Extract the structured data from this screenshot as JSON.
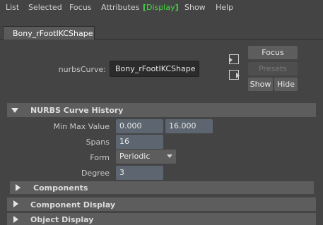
{
  "menu": {
    "list": "List",
    "selected": "Selected",
    "focus": "Focus",
    "attributes": "Attributes",
    "display": "Display",
    "show": "Show",
    "help": "Help"
  },
  "tab": {
    "label": "Bony_rFootIKCShape"
  },
  "node": {
    "label": "nurbsCurve:",
    "value": "Bony_rFootIKCShape"
  },
  "side_buttons": {
    "focus": "Focus",
    "presets": "Presets",
    "show": "Show",
    "hide": "Hide"
  },
  "sections": {
    "history": "NURBS Curve History",
    "components": "Components",
    "component_display": "Component Display",
    "object_display": "Object Display"
  },
  "history": {
    "minmax_label": "Min Max Value",
    "min_value": "0.000",
    "max_value": "16.000",
    "spans_label": "Spans",
    "spans_value": "16",
    "form_label": "Form",
    "form_value": "Periodic",
    "degree_label": "Degree",
    "degree_value": "3"
  },
  "colors": {
    "background": "#444444",
    "highlight_menu": "#3fdc3f",
    "field": "#5d6670",
    "section_header": "#5d5d5d"
  }
}
